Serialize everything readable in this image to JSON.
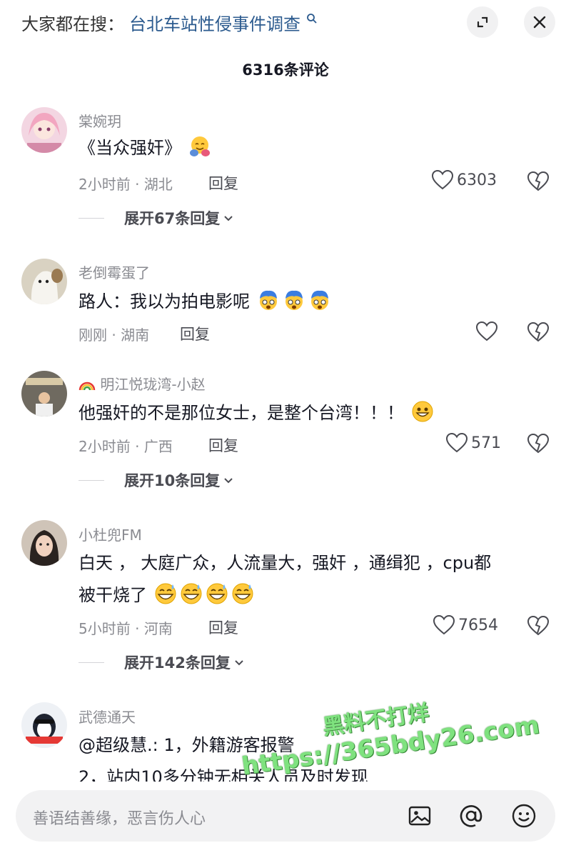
{
  "header": {
    "search_prefix": "大家都在搜：",
    "search_query": "台北车站性侵事件调查",
    "comment_count_title": "6316条评论"
  },
  "comments": [
    {
      "username": "棠婉玥",
      "text": "《当众强奸》",
      "meta": "2小时前 · 湖北",
      "reply_label": "回复",
      "likes": "6303",
      "expand_label": "展开67条回复"
    },
    {
      "username": "老倒霉蛋了",
      "text": "路人：我以为拍电影呢",
      "meta": "刚刚 · 湖南",
      "reply_label": "回复",
      "likes": ""
    },
    {
      "username": "明江悦珑湾-小赵",
      "text": "他强奸的不是那位女士，是整个台湾！！！",
      "meta": "2小时前 · 广西",
      "reply_label": "回复",
      "likes": "571",
      "expand_label": "展开10条回复"
    },
    {
      "username": "小杜兜FM",
      "text_line1": "白天 ， 大庭广众，人流量大，强奸 ，通缉犯 ，cpu都",
      "text_line2": "被干烧了",
      "meta": "5小时前 · 河南",
      "reply_label": "回复",
      "likes": "7654",
      "expand_label": "展开142条回复"
    },
    {
      "username": "武德通天",
      "text_line1": "@超级慧.: 1，外籍游客报警",
      "text_line2": "2，站内10多分钟无相关人员及时发现"
    }
  ],
  "bottom_bar": {
    "placeholder": "善语结善缘，恶言伤人心"
  },
  "watermark": {
    "line1": "黑料不打烊",
    "line2": "https://365bdy26.com"
  },
  "colors": {
    "link": "#2b5a8e",
    "muted": "#8a8b91",
    "text": "#161823",
    "button_bg": "#f1f1f2"
  }
}
